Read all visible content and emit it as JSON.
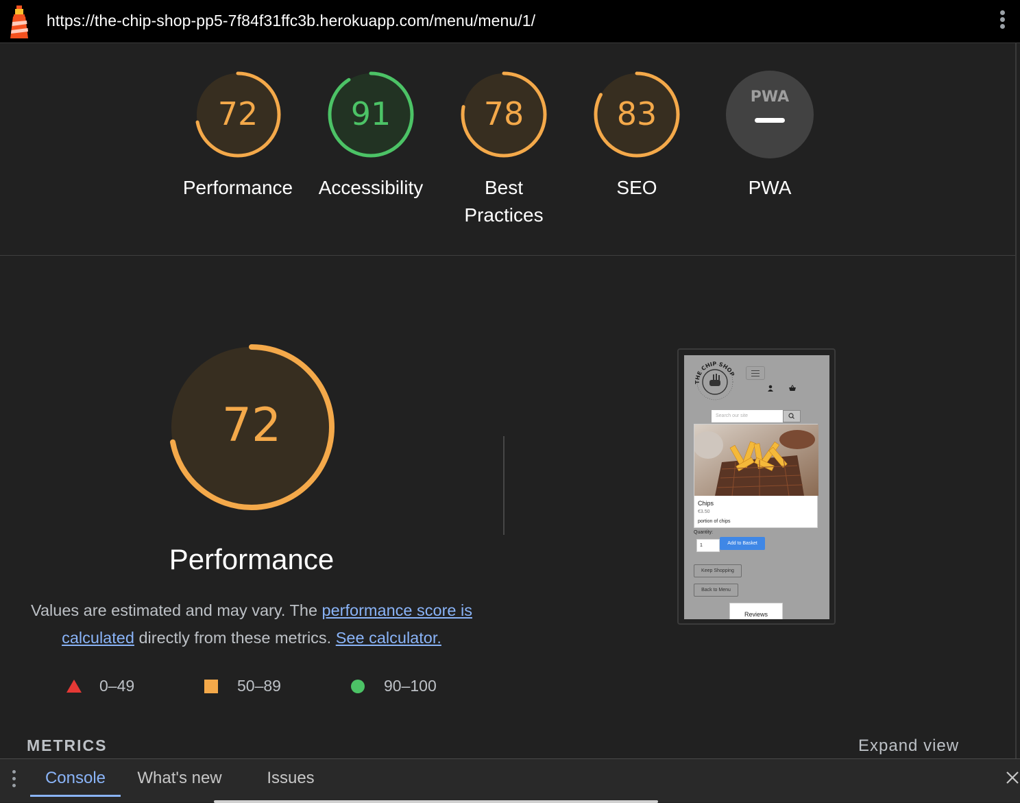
{
  "url": "https://the-chip-shop-pp5-7f84f31ffc3b.herokuapp.com/menu/menu/1/",
  "colors": {
    "average": "#f4a94a",
    "pass": "#4cc366",
    "fail": "#e53935",
    "pwa_bg": "#424242"
  },
  "gauges": [
    {
      "score": "72",
      "fraction": 0.72,
      "label": "Performance",
      "status": "average"
    },
    {
      "score": "91",
      "fraction": 0.91,
      "label": "Accessibility",
      "status": "pass"
    },
    {
      "score": "78",
      "fraction": 0.78,
      "label": "Best Practices",
      "status": "average"
    },
    {
      "score": "83",
      "fraction": 0.83,
      "label": "SEO",
      "status": "average"
    },
    {
      "score": "",
      "badge": "PWA",
      "label": "PWA",
      "status": "na"
    }
  ],
  "performance": {
    "score": "72",
    "fraction": 0.72,
    "title": "Performance",
    "desc_text_1": "Values are estimated and may vary. The ",
    "desc_link_1": "performance score is calculated",
    "desc_text_2": " directly from these metrics. ",
    "desc_link_2": "See calculator."
  },
  "legend": [
    {
      "shape": "triangle-icon",
      "range": "0–49"
    },
    {
      "shape": "square-icon",
      "range": "50–89"
    },
    {
      "shape": "circle-icon",
      "range": "90–100"
    }
  ],
  "metrics": {
    "header": "METRICS",
    "expand": "Expand view"
  },
  "screenshot": {
    "logo_text": "THE CHIP SHOP",
    "search_placeholder": "Search our site",
    "item_name": "Chips",
    "item_price": "€3.50",
    "item_desc": "portion of chips",
    "qty_label": "Quantity:",
    "qty_value": "1",
    "add_button": "Add to Basket",
    "keep_button": "Keep Shopping",
    "back_button": "Back to Menu",
    "reviews_tab": "Reviews"
  },
  "drawer": {
    "tabs": [
      "Console",
      "What's new",
      "Issues"
    ]
  }
}
